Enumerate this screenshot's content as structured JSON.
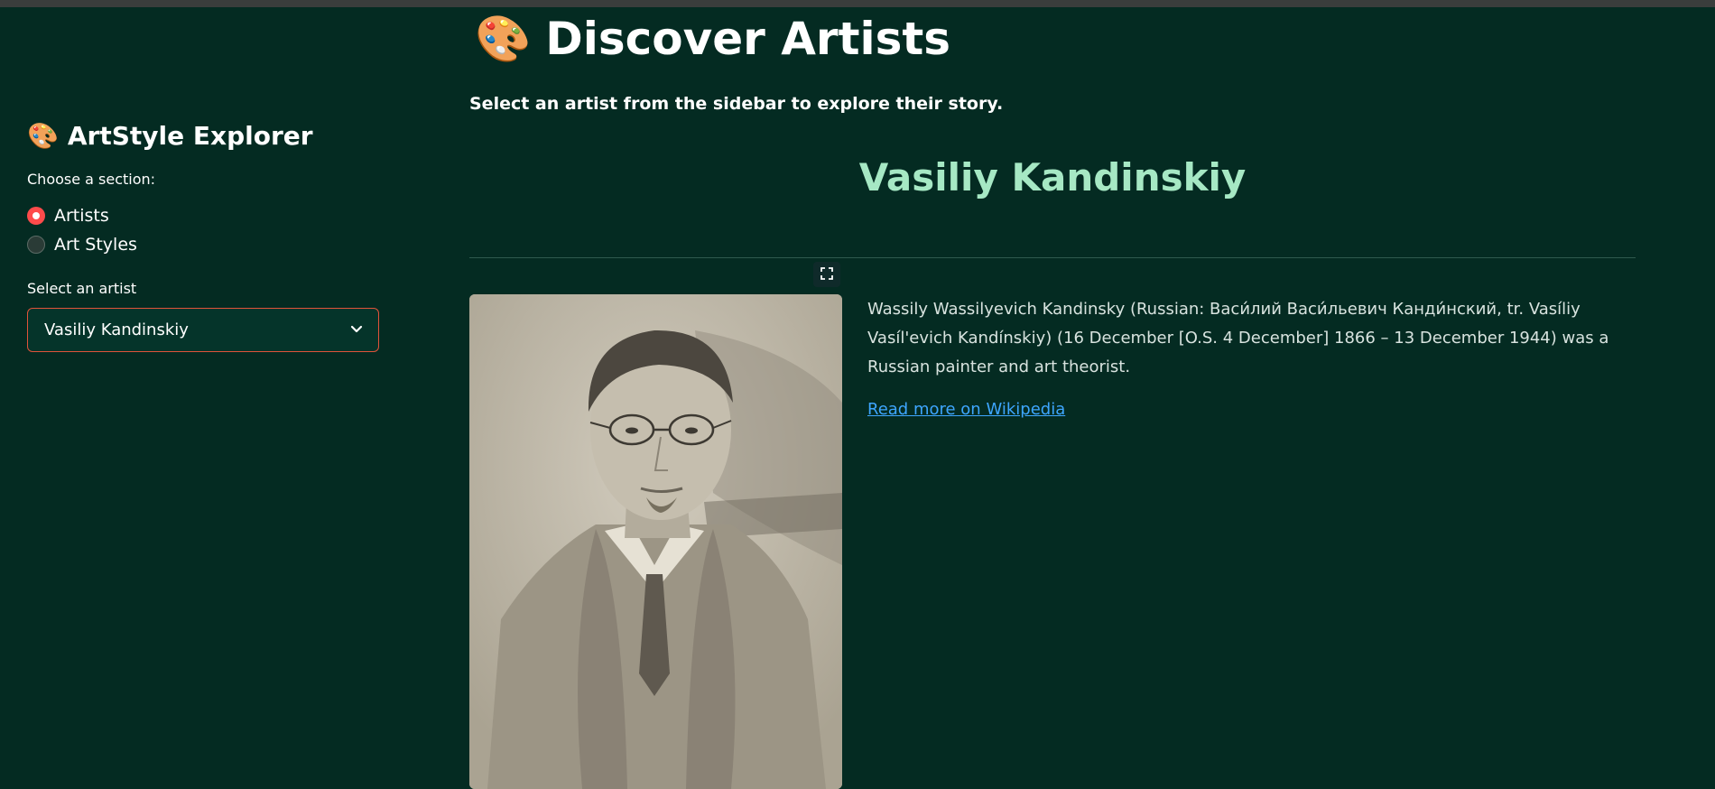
{
  "sidebar": {
    "app_emoji": "🎨",
    "app_title": "ArtStyle Explorer",
    "section_label": "Choose a section:",
    "sections": [
      {
        "label": "Artists",
        "selected": true
      },
      {
        "label": "Art Styles",
        "selected": false
      }
    ],
    "artist_label": "Select an artist",
    "artist_selected": "Vasiliy Kandinskiy"
  },
  "main": {
    "title_emoji": "🎨",
    "title": "Discover Artists",
    "subtitle": "Select an artist from the sidebar to explore their story.",
    "artist_name": "Vasiliy Kandinskiy",
    "bio": "Wassily Wassilyevich Kandinsky (Russian: Васи́лий Васи́льевич Канди́нский, tr. Vasíliy Vasíl'evich Kandínskiy) (16 December [O.S. 4 December] 1866 – 13 December 1944) was a Russian painter and art theorist.",
    "wiki_link": "Read more on Wikipedia"
  },
  "colors": {
    "background": "#042b22",
    "accent": "#ff4b4b",
    "artist_name": "#a6e8c4",
    "link": "#3ea6ff"
  },
  "icons": {
    "expand": "fullscreen-icon",
    "select": "chevron-down-icon"
  }
}
